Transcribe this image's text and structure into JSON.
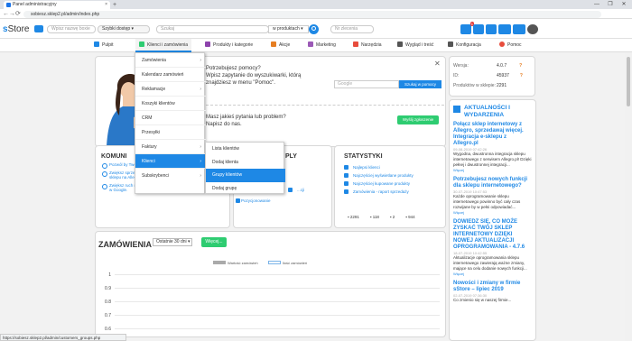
{
  "browser": {
    "tab_title": "Panel administracyjny",
    "new_tab": "+",
    "url": "sobiesz.sklep2.pl/admin/index.php",
    "min": "—",
    "max": "❐",
    "close": "✕",
    "back": "←",
    "forward": "→",
    "reload": "⟳"
  },
  "header": {
    "logo_s": "s",
    "logo_rest": "Store",
    "quick_placeholder": "Wpisz nazwę boxie",
    "quick_select": "Szybki dostęp",
    "search_placeholder": "Szukaj",
    "search_scope": "w produktach",
    "order_placeholder": "Nr zlecenia",
    "notification_count": "1"
  },
  "menu": [
    {
      "label": "Pulpit",
      "color": "#1e88e5"
    },
    {
      "label": "Klienci i zamówienia",
      "color": "#2ecc71"
    },
    {
      "label": "Produkty i kategorie",
      "color": "#8e44ad"
    },
    {
      "label": "Akcje",
      "color": "#e67e22"
    },
    {
      "label": "Marketing",
      "color": "#9b59b6"
    },
    {
      "label": "Narzędzia",
      "color": "#e74c3c"
    },
    {
      "label": "Wygląd i treść",
      "color": "#555555"
    },
    {
      "label": "Konfiguracja",
      "color": "#555555"
    },
    {
      "label": "Pomoc",
      "color": "#e74c3c"
    }
  ],
  "dropdown": [
    {
      "label": "Zamówienia",
      "arrow": "›"
    },
    {
      "label": "Kalendarz zamówień",
      "arrow": ""
    },
    {
      "label": "Reklamacje",
      "arrow": "›"
    },
    {
      "label": "Koszyki klientów",
      "arrow": ""
    },
    {
      "label": "CRM",
      "arrow": ""
    },
    {
      "label": "Przesyłki",
      "arrow": ""
    },
    {
      "label": "Faktury",
      "arrow": "›"
    },
    {
      "label": "Klienci",
      "arrow": "›"
    },
    {
      "label": "Subskrybenci",
      "arrow": "›"
    }
  ],
  "submenu": [
    "Lista klientów",
    "Dodaj klienta",
    "Grupy klientów",
    "Dodaj grupę"
  ],
  "welcome": {
    "q1a": "Potrzebujesz pomocy?",
    "q1b": "Wpisz zapytanie do wyszukiwarki, którą",
    "q1c": "znajdziesz w menu \"Pomoc\".",
    "help_placeholder": "Google",
    "help_button": "Szukaj w pomocy",
    "q2a": "Masz jakieś pytania lub problem?",
    "q2b": "Napisz do nas.",
    "send_button": "Wyślij zgłoszenie",
    "close": "✕"
  },
  "komunikaty": {
    "title": "KOMUNI",
    "items": [
      "Pozwól by Twoi klienci przeszli w Allegro.pl",
      "Zwiększ sprzedaż w e-sklepie, promuj produkty ze swojego sklepu na Allegro.pl jeden kliknięcie",
      "Zwiększ ruch na stronie sklepu dzięki pozycjonowaniu i reklamie w Google."
    ]
  },
  "produkty": {
    "title": "PLY",
    "items": [
      "...cji",
      "Pozycjonowanie"
    ]
  },
  "statystyki": {
    "title": "STATYSTYKI",
    "items": [
      "Najlepsi klienci",
      "Najczęściej wyświetlane produkty",
      "Najczęściej kupowane produkty",
      "Zamówienia - raport sprzedaży"
    ],
    "counters": [
      "2291",
      "118",
      "2",
      "944"
    ]
  },
  "zamowienia": {
    "title": "ZAMÓWIENIA",
    "range": "Ostatnie 30 dni",
    "button": "Więcej...",
    "legend1": "Wartość zamówień",
    "legend2": "Ilość zamówień",
    "yticks": [
      "1",
      "0.9",
      "0.8",
      "0.7",
      "0.6"
    ]
  },
  "version": {
    "rows": [
      {
        "k": "Wersja:",
        "v": "4.0.7"
      },
      {
        "k": "ID:",
        "v": "45937"
      },
      {
        "k": "Produktów w sklepie:",
        "v": "2291"
      }
    ]
  },
  "news": {
    "title": "AKTUALNOŚCI I WYDARZENIA",
    "items": [
      {
        "t": "Połącz sklep internetowy z Allegro, sprzedawaj więcej. Integracja e-sklepu z Allegro.pl",
        "d": "09-08-2019 07:42:26",
        "x": "Wygodna, dwustronna integracja sklepu internetowego z serwisem Allegro.pl! Dzięki pełnej i dwustronnej integracji...",
        "m": "Więcej"
      },
      {
        "t": "Potrzebujesz nowych funkcji dla sklepu internetowego?",
        "d": "30-07-2019 10:47:53",
        "x": "Każde oprogramowanie sklepu internetowego powinno być cały czas rozwijane by w pełni odpowiadać...",
        "m": "Więcej"
      },
      {
        "t": "DOWIEDZ SIĘ, CO MOŻE ZYSKAĆ TWÓJ SKLEP INTERNETOWY DZIĘKI NOWEJ AKTUALIZACJI OPROGRAMOWANIA - 4.7.6",
        "d": "18-07-2019 10:42:55",
        "x": "Aktualizacje oprogramowania sklepu internetowego zawierają ważne zmiany, mające na celu dodanie nowych funkcji...",
        "m": "Więcej"
      },
      {
        "t": "Nowości i zmiany w firmie sStore – lipiec 2019",
        "d": "02-07-2019 07:36:30",
        "x": "Co zmienio się w naszej firmie...",
        "m": ""
      }
    ]
  },
  "status_url": "https://sobiesz.sklep2.pl/admin/customers_groups.php"
}
